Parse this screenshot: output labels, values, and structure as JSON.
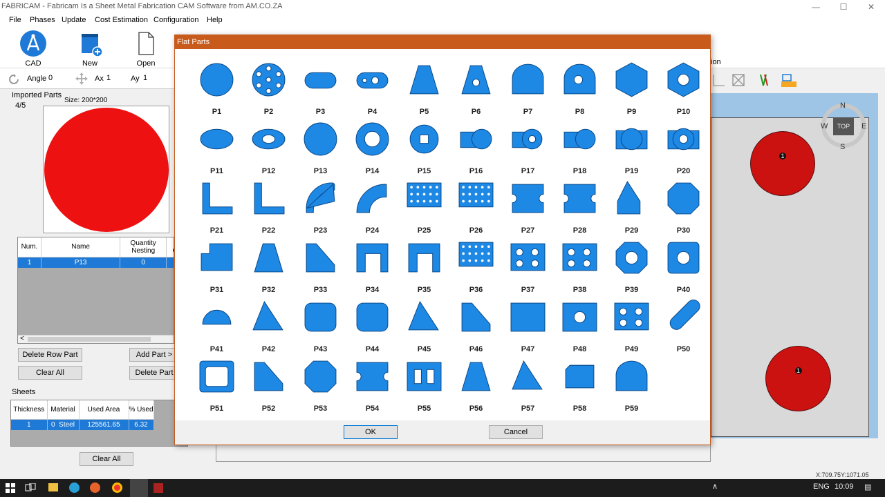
{
  "window": {
    "title": "FABRICAM - Fabricam Is a Sheet Metal Fabrication CAM Software from AM.CO.ZA",
    "minimize": "—",
    "maximize": "☐",
    "close": "✕"
  },
  "menu": [
    "File",
    "Phases",
    "Update",
    "Cost Estimation",
    "Configuration",
    "Help"
  ],
  "ribbon": {
    "cad_label": "CAD",
    "new_sheet_label": "New Sheet",
    "open_file_label": "Open File",
    "right_text": "ion"
  },
  "coords": {
    "angle_label": "Angle",
    "angle_value": "0",
    "ax_label": "Ax",
    "ax_value": "1",
    "ay_label": "Ay",
    "ay_value": "1"
  },
  "imported_parts": {
    "title": "Imported Parts",
    "counter": "4/5",
    "size": "Size: 200*200",
    "columns": [
      "Num.",
      "Name",
      "Quantity Nesting",
      "Manu Quant"
    ],
    "rows": [
      {
        "num": "1",
        "name": "P13",
        "qty": "0"
      }
    ],
    "scroll_left": "<"
  },
  "buttons": {
    "delete_row_part": "Delete Row Part",
    "add_part": "Add Part >",
    "clear_all": "Clear All",
    "delete_part": "Delete Part",
    "sheets_clear_all": "Clear All"
  },
  "sheets": {
    "title": "Sheets",
    "columns": [
      "Thickness",
      "Material",
      "Used Area",
      "% Used"
    ],
    "rows": [
      {
        "thickness": "1",
        "matid": "0",
        "material": "Steel",
        "used_area": "125561.65",
        "pct": "6.32"
      }
    ]
  },
  "canvas": {
    "nav": {
      "n": "N",
      "s": "S",
      "e": "E",
      "w": "W",
      "top": "TOP"
    },
    "parts": [
      {
        "label": "1"
      },
      {
        "label": "1"
      }
    ]
  },
  "dialog": {
    "title": "Flat Parts",
    "ok": "OK",
    "cancel": "Cancel",
    "parts": [
      "P1",
      "P2",
      "P3",
      "P4",
      "P5",
      "P6",
      "P7",
      "P8",
      "P9",
      "P10",
      "P11",
      "P12",
      "P13",
      "P14",
      "P15",
      "P16",
      "P17",
      "P18",
      "P19",
      "P20",
      "P21",
      "P22",
      "P23",
      "P24",
      "P25",
      "P26",
      "P27",
      "P28",
      "P29",
      "P30",
      "P31",
      "P32",
      "P33",
      "P34",
      "P35",
      "P36",
      "P37",
      "P38",
      "P39",
      "P40",
      "P41",
      "P42",
      "P43",
      "P44",
      "P45",
      "P46",
      "P47",
      "P48",
      "P49",
      "P50",
      "P51",
      "P52",
      "P53",
      "P54",
      "P55",
      "P56",
      "P57",
      "P58",
      "P59"
    ],
    "part_color": "#1e88e5"
  },
  "status": {
    "xy": "X:709.75Y:1071.05"
  },
  "taskbar": {
    "lang": "ENG",
    "time": "10:09"
  }
}
